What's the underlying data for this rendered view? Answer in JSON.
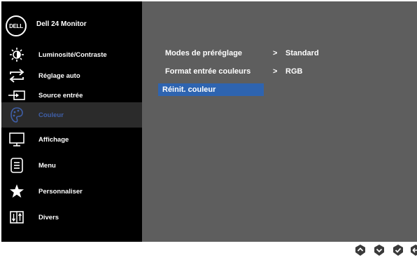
{
  "header": {
    "logo_text": "DELL",
    "model": "Dell 24 Monitor"
  },
  "menu": [
    {
      "label": "Luminosité/Contraste",
      "icon": "brightness-icon",
      "active": false
    },
    {
      "label": "Réglage auto",
      "icon": "auto-adjust-icon",
      "active": false
    },
    {
      "label": "Source entrée",
      "icon": "input-source-icon",
      "active": false
    },
    {
      "label": "Couleur",
      "icon": "color-palette-icon",
      "active": true
    },
    {
      "label": "Affichage",
      "icon": "display-icon",
      "active": false
    },
    {
      "label": "Menu",
      "icon": "menu-icon",
      "active": false
    },
    {
      "label": "Personnaliser",
      "icon": "star-icon",
      "active": false
    },
    {
      "label": "Divers",
      "icon": "others-icon",
      "active": false
    }
  ],
  "submenu": [
    {
      "name": "Modes de préréglage",
      "arrow": ">",
      "value": "Standard",
      "selected": false
    },
    {
      "name": "Format entrée couleurs",
      "arrow": ">",
      "value": "RGB",
      "selected": false
    },
    {
      "name": "Réinit. couleur",
      "arrow": "",
      "value": "",
      "selected": true
    }
  ],
  "colors": {
    "selected_bg": "#2e64b0",
    "active_label": "#3f5fa8",
    "panel_bg": "#5e5e5e"
  },
  "control_buttons": [
    "up-button-icon",
    "down-button-icon",
    "ok-button-icon",
    "back-button-icon"
  ]
}
